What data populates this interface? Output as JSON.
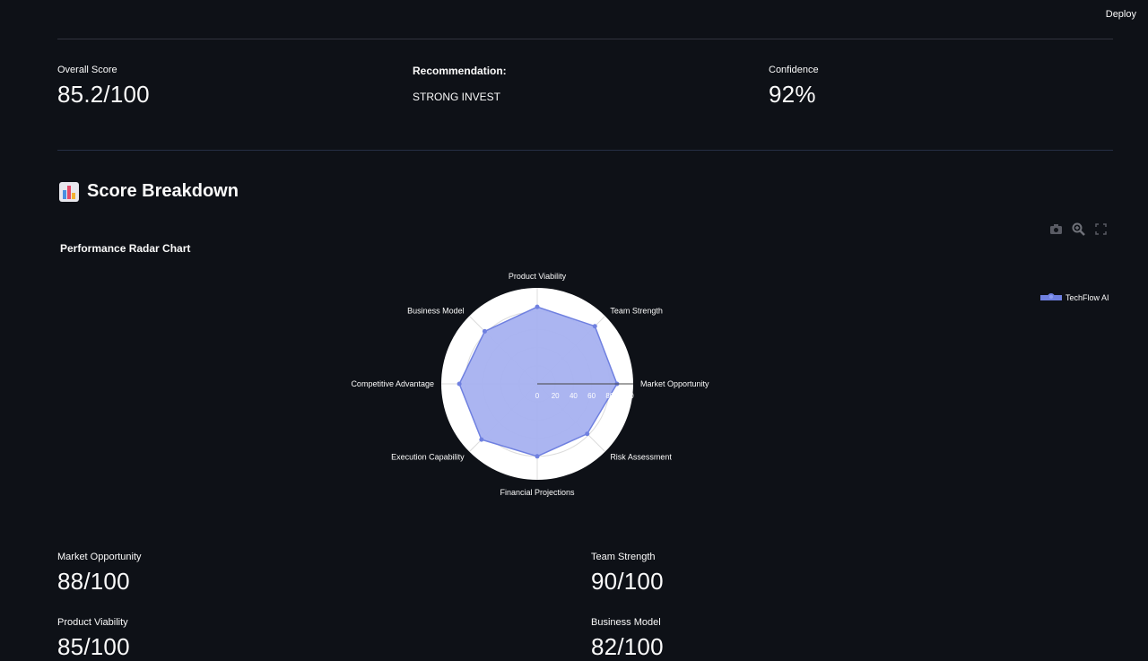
{
  "header": {
    "deploy_label": "Deploy"
  },
  "summary": {
    "overall_label": "Overall Score",
    "overall_value": "85.2/100",
    "recommendation_label": "Recommendation:",
    "recommendation_value": "STRONG INVEST",
    "confidence_label": "Confidence",
    "confidence_value": "92%"
  },
  "section": {
    "title": "Score Breakdown",
    "emoji_icon": "bar-chart-icon"
  },
  "chart_title": "Performance Radar Chart",
  "toolbar_icons": [
    "camera-icon",
    "zoom-icon",
    "fullscreen-icon"
  ],
  "chart_data": {
    "type": "radar",
    "title": "Performance Radar Chart",
    "categories": [
      "Market Opportunity",
      "Team Strength",
      "Product Viability",
      "Business Model",
      "Competitive Advantage",
      "Execution Capability",
      "Financial Projections",
      "Risk Assessment"
    ],
    "series": [
      {
        "name": "TechFlow AI",
        "values": [
          88,
          90,
          85,
          82,
          86,
          87,
          80,
          78
        ]
      }
    ],
    "radial_ticks": [
      "0",
      "20",
      "40",
      "60",
      "80",
      "100"
    ],
    "range": [
      0,
      100
    ],
    "legend_position": "top-right",
    "colors": {
      "fill": "#a6b1f0",
      "line": "#6f80e0",
      "background": "#ffffff"
    }
  },
  "metrics": [
    {
      "label": "Market Opportunity",
      "value": "88/100"
    },
    {
      "label": "Team Strength",
      "value": "90/100"
    },
    {
      "label": "Product Viability",
      "value": "85/100"
    },
    {
      "label": "Business Model",
      "value": "82/100"
    }
  ]
}
